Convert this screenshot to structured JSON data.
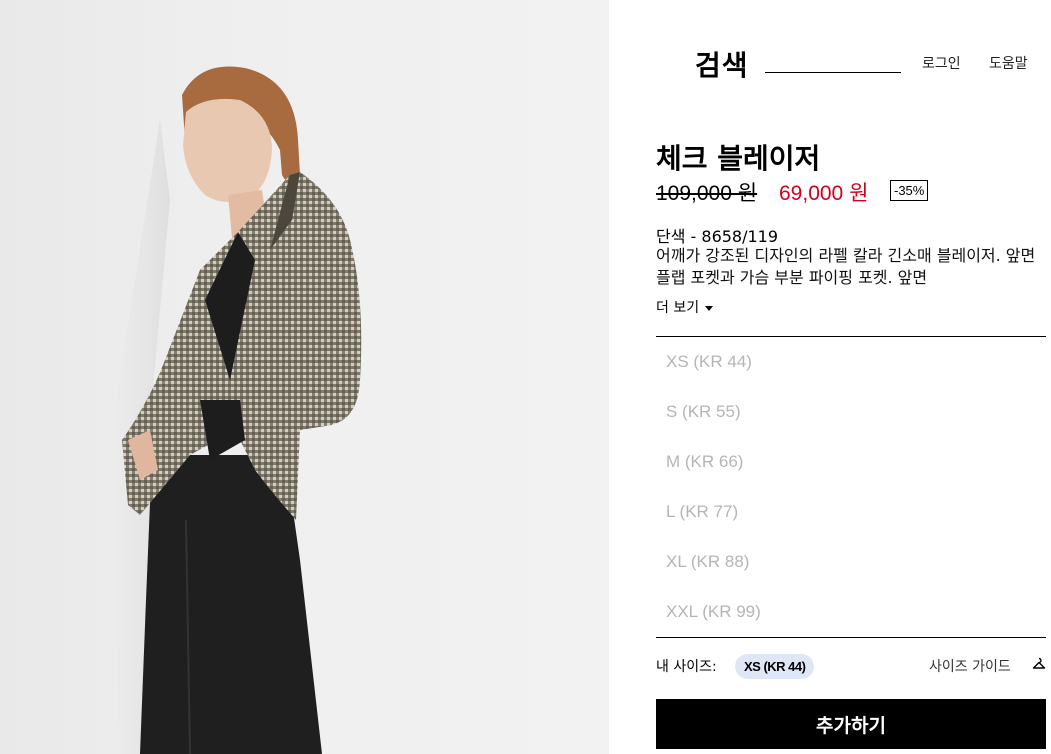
{
  "header": {
    "search_label": "검색",
    "search_value": "",
    "login": "로그인",
    "help": "도움말"
  },
  "product": {
    "title": "체크 블레이저",
    "old_price": "109,000 원",
    "new_price": "69,000 원",
    "discount": "-35%",
    "color_ref": "단색 - 8658/119",
    "description": "어깨가 강조된 디자인의 라펠 칼라 긴소매 블레이저. 앞면 플랩 포켓과 가슴 부분 파이핑 포켓. 앞면",
    "more_label": "더 보기"
  },
  "sizes": [
    "XS (KR 44)",
    "S (KR 55)",
    "M (KR 66)",
    "L (KR 77)",
    "XL (KR 88)",
    "XXL (KR 99)"
  ],
  "my_size": {
    "label": "내 사이즈:",
    "value": "XS (KR 44)"
  },
  "size_guide": {
    "label": "사이즈 가이드",
    "icon": "hanger-icon"
  },
  "add_button": "추가하기",
  "colors": {
    "sale_price": "#d0021b",
    "my_size_pill": "#dfe7f7",
    "size_unavailable": "#b5b5b5"
  }
}
